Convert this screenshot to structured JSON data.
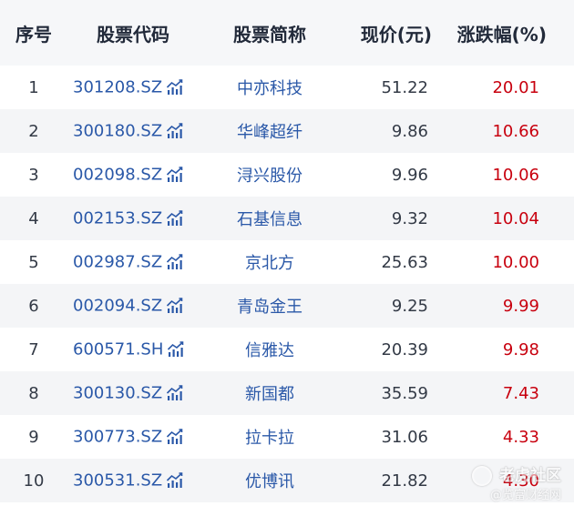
{
  "table": {
    "headers": {
      "index": "序号",
      "code": "股票代码",
      "name": "股票简称",
      "price": "现价(元)",
      "change": "涨跌幅(%)"
    },
    "rows": [
      {
        "index": "1",
        "code": "301208.SZ",
        "name": "中亦科技",
        "price": "51.22",
        "change": "20.01"
      },
      {
        "index": "2",
        "code": "300180.SZ",
        "name": "华峰超纤",
        "price": "9.86",
        "change": "10.66"
      },
      {
        "index": "3",
        "code": "002098.SZ",
        "name": "浔兴股份",
        "price": "9.96",
        "change": "10.06"
      },
      {
        "index": "4",
        "code": "002153.SZ",
        "name": "石基信息",
        "price": "9.32",
        "change": "10.04"
      },
      {
        "index": "5",
        "code": "002987.SZ",
        "name": "京北方",
        "price": "25.63",
        "change": "10.00"
      },
      {
        "index": "6",
        "code": "002094.SZ",
        "name": "青岛金王",
        "price": "9.25",
        "change": "9.99"
      },
      {
        "index": "7",
        "code": "600571.SH",
        "name": "信雅达",
        "price": "20.39",
        "change": "9.98"
      },
      {
        "index": "8",
        "code": "300130.SZ",
        "name": "新国都",
        "price": "35.59",
        "change": "7.43"
      },
      {
        "index": "9",
        "code": "300773.SZ",
        "name": "拉卡拉",
        "price": "31.06",
        "change": "4.33"
      },
      {
        "index": "10",
        "code": "300531.SZ",
        "name": "优博讯",
        "price": "21.82",
        "change": "4.30"
      }
    ]
  },
  "watermark": {
    "line1": "老虎社区",
    "line2": "@览富财经网"
  },
  "icons": {
    "trend": "trend-chart-icon"
  },
  "colors": {
    "link": "#2a58a8",
    "up": "#c8000e",
    "header_bg": "#f6f7f9",
    "stripe_bg": "#f4f5f7"
  }
}
